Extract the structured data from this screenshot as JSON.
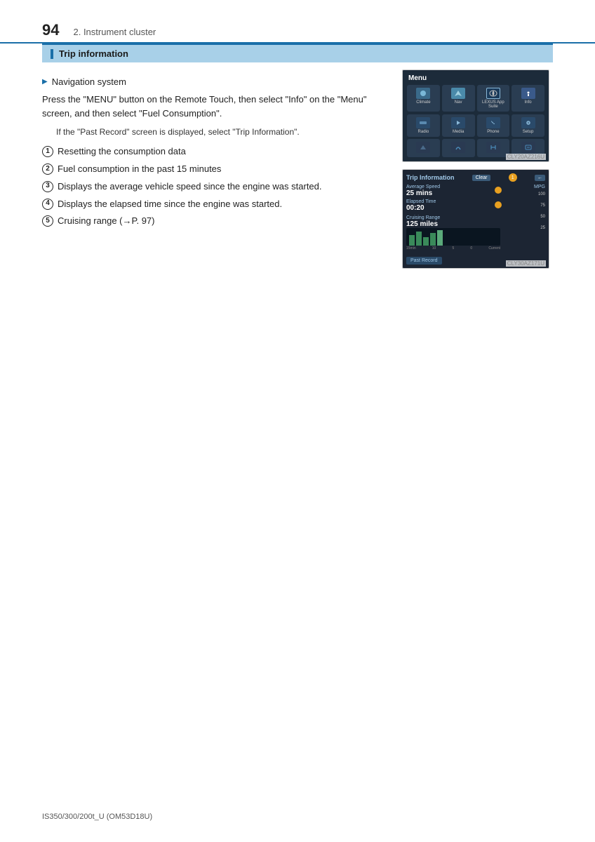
{
  "page": {
    "number": "94",
    "chapter": "2. Instrument cluster",
    "footer": "IS350/300/200t_U (OM53D18U)"
  },
  "section": {
    "title": "Trip information"
  },
  "nav_item": {
    "label": "Navigation system"
  },
  "paragraph1": "Press the \"MENU\" button on the Remote Touch, then select \"Info\" on the \"Menu\" screen, and then select \"Fuel Consumption\".",
  "indented_note": "If the \"Past Record\" screen is displayed, select \"Trip Information\".",
  "numbered_items": [
    {
      "num": "①",
      "text": "Resetting the consumption data"
    },
    {
      "num": "②",
      "text": "Fuel consumption in the past 15 minutes"
    },
    {
      "num": "③",
      "text": "Displays the average vehicle speed since the engine was started."
    },
    {
      "num": "④",
      "text": "Displays the elapsed time since the engine was started."
    },
    {
      "num": "⑤",
      "text": "Cruising range (→P. 97)"
    }
  ],
  "screen1": {
    "label": "CLY20AZ216U",
    "menu_title": "Menu",
    "items_row1": [
      "Climate",
      "Nav",
      "LEXUS App Suite",
      "Info"
    ],
    "items_row2": [
      "Radio",
      "Media",
      "Phone",
      "Setup"
    ]
  },
  "screen2": {
    "label": "CLY30AZ171U",
    "title": "Trip Information",
    "clear_btn": "Clear",
    "back_btn": "←",
    "avg_speed_label": "Average Speed",
    "avg_speed_value": "25 mins",
    "elapsed_label": "Elapsed Time",
    "elapsed_value": "00:20",
    "cruise_label": "Cruising Range",
    "cruise_value": "125 miles",
    "past_record_btn": "Past Record",
    "mpg_label": "MPG",
    "scale_100": "100",
    "scale_75": "75",
    "scale_50": "50",
    "scale_25": "25",
    "chart_labels": [
      "15min",
      "10",
      "5",
      "0",
      "Current"
    ]
  }
}
